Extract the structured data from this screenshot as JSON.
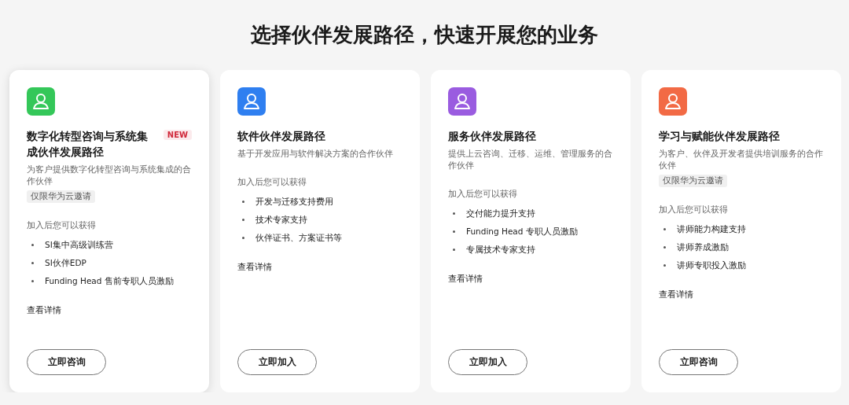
{
  "heading": "选择伙伴发展路径，快速开展您的业务",
  "cards": [
    {
      "title": "数字化转型咨询与系统集成伙伴发展路径",
      "badge": "NEW",
      "color": "#34c759",
      "highlighted": true,
      "description": "为客户提供数字化转型咨询与系统集成的合作伙伴",
      "tag": "仅限华为云邀请",
      "benefits_label": "加入后您可以获得",
      "benefits": [
        "SI集中高级训练营",
        "SI伙伴EDP",
        "Funding Head 售前专职人员激励"
      ],
      "details_link": "查看详情",
      "button": "立即咨询"
    },
    {
      "title": "软件伙伴发展路径",
      "color": "#2f7ff0",
      "highlighted": false,
      "description": "基于开发应用与软件解决方案的合作伙伴",
      "benefits_label": "加入后您可以获得",
      "benefits": [
        "开发与迁移支持费用",
        "技术专家支持",
        "伙伴证书、方案证书等"
      ],
      "details_link": "查看详情",
      "button": "立即加入"
    },
    {
      "title": "服务伙伴发展路径",
      "color": "#9a5ce0",
      "highlighted": false,
      "description": "提供上云咨询、迁移、运维、管理服务的合作伙伴",
      "benefits_label": "加入后您可以获得",
      "benefits": [
        "交付能力提升支持",
        "Funding Head 专职人员激励",
        "专属技术专家支持"
      ],
      "details_link": "查看详情",
      "button": "立即加入"
    },
    {
      "title": "学习与赋能伙伴发展路径",
      "color": "#f26a45",
      "highlighted": false,
      "description": "为客户、伙伴及开发者提供培训服务的合作伙伴",
      "tag": "仅限华为云邀请",
      "benefits_label": "加入后您可以获得",
      "benefits": [
        "讲师能力构建支持",
        "讲师养成激励",
        "讲师专职投入激励"
      ],
      "details_link": "查看详情",
      "button": "立即咨询"
    }
  ]
}
